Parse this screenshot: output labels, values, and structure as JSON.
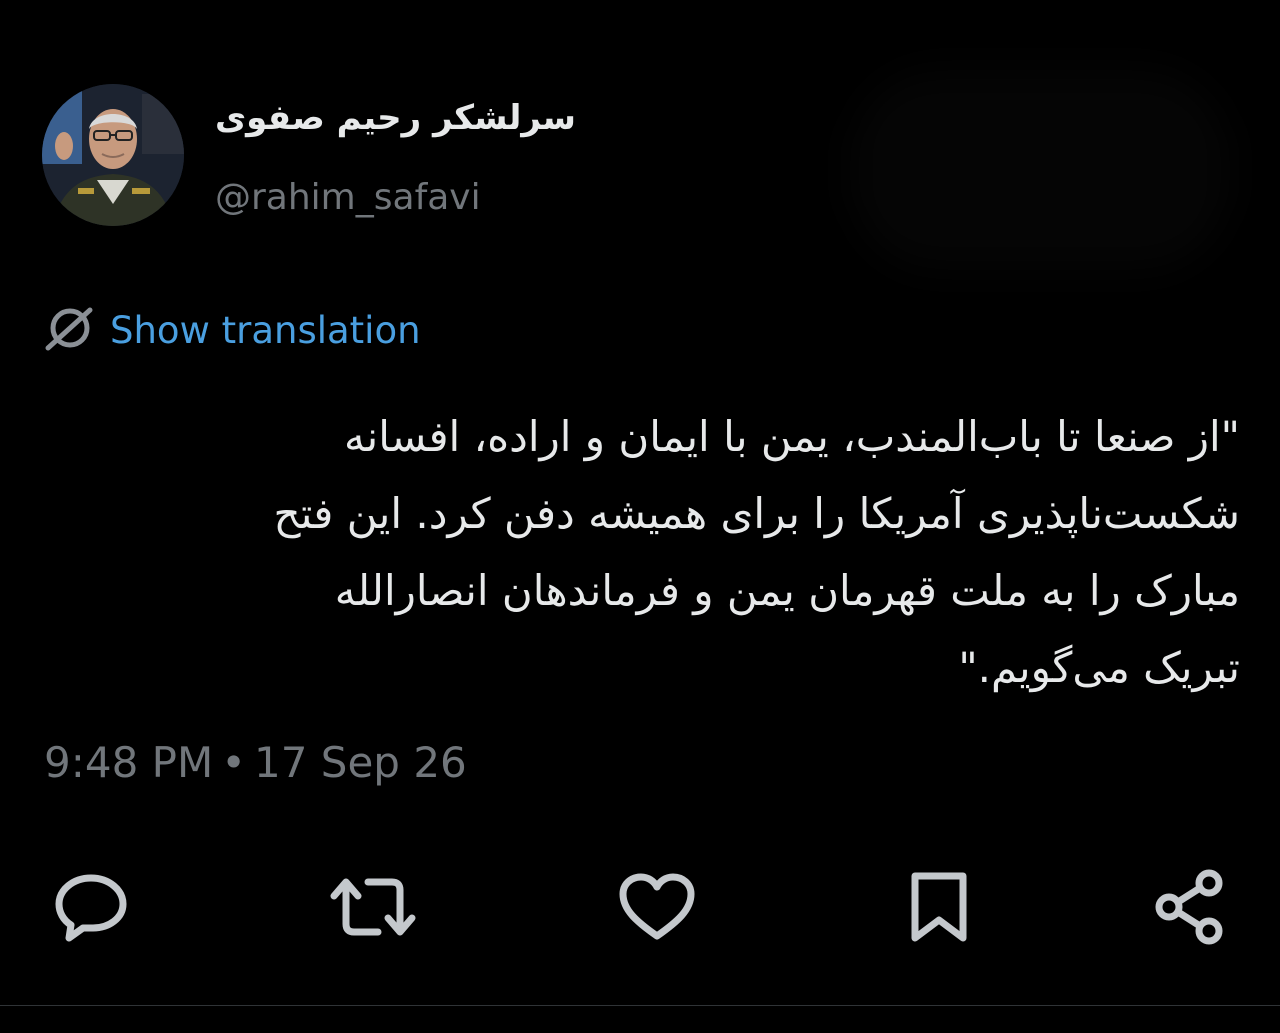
{
  "tweet": {
    "author": {
      "display_name": "سرلشکر رحیم صفوی",
      "handle": "@rahim_safavi"
    },
    "translate_label": "Show translation",
    "text_lines": [
      "\"از صنعا تا باب‌المندب، یمن با ایمان و اراده، افسانه",
      "شکست‌ناپذیری آمریکا را برای همیشه دفن کرد. این فتح",
      "مبارک را به ملت قهرمان یمن و فرماندهان انصارالله",
      "تبریک می‌گویم.\""
    ],
    "time": "9:48 PM",
    "separator": "•",
    "date": "17 Sep 26"
  },
  "actions": [
    {
      "name": "reply",
      "icon": "reply-icon"
    },
    {
      "name": "retweet",
      "icon": "retweet-icon"
    },
    {
      "name": "like",
      "icon": "heart-icon"
    },
    {
      "name": "bookmark",
      "icon": "bookmark-icon"
    },
    {
      "name": "share",
      "icon": "share-icon"
    }
  ],
  "colors": {
    "background": "#000000",
    "text": "#e7e9ea",
    "secondary": "#71767b",
    "link": "#4a9fe0",
    "icon": "#c4c8cc"
  }
}
